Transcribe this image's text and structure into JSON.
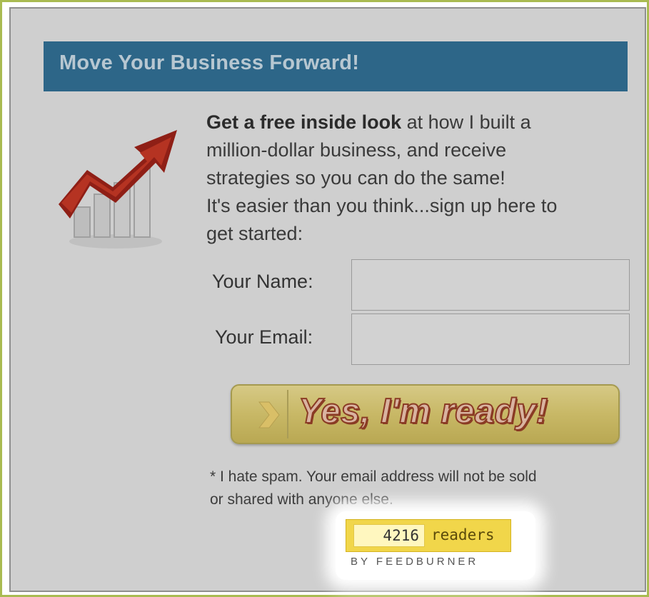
{
  "header": {
    "title": "Move Your Business Forward!"
  },
  "promo": {
    "bold_lead": "Get a free inside look",
    "line1_rest": " at how I built a",
    "line2": "million-dollar business, and receive",
    "line3": "strategies so you can do the same!",
    "line4": "It's easier than you think...sign up here to",
    "line5": "get started:"
  },
  "form": {
    "name_label": "Your Name:",
    "name_value": "",
    "email_label": "Your Email:",
    "email_value": ""
  },
  "cta": {
    "label": "Yes, I'm ready!"
  },
  "disclaimer": {
    "line1": "* I hate spam. Your email address will not be sold",
    "line2": "or shared with anyone else."
  },
  "feedburner": {
    "count": "4216",
    "unit": "readers",
    "byline": "BY FEEDBURNER"
  },
  "icons": {
    "growth_chart": "growth-chart-icon",
    "cta_chevron": "chevron-right-icon"
  }
}
